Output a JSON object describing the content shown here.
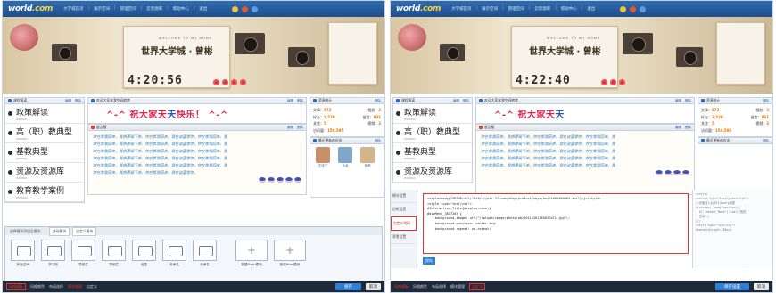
{
  "header": {
    "logo": "world",
    "logo_suffix": ".com",
    "nav": [
      "大学城首页",
      "展示空间",
      "管理空间",
      "云资源库",
      "帮助中心",
      "退出"
    ]
  },
  "banner": {
    "title": "世界大学城 · 曾彬",
    "subtitle": "WELCOME TO MY HOME",
    "clock_left": "4:20:56",
    "clock_right": "4:22:40"
  },
  "left_panel": {
    "categories_head": {
      "title": "课程解读",
      "edit": "编辑",
      "delete": "删除"
    },
    "categories": [
      {
        "name": "政策解读",
        "sub": "worlduc"
      },
      {
        "name": "高（职）教典型",
        "sub": "worlduc"
      },
      {
        "name": "基教典型",
        "sub": "worlduc"
      },
      {
        "name": "资源及资源库",
        "sub": "worlduc"
      },
      {
        "name": "教育教学案例",
        "sub": "worlduc"
      }
    ],
    "greeting_head": {
      "title": "欢迎大家来我空间转转",
      "edit": "编辑",
      "delete": "删除"
    },
    "greeting_prefix": "^-^ 祝大家天",
    "greeting_mid": "天",
    "greeting_suffix": "快乐！ ^-^",
    "notes_head": {
      "title": "留言板",
      "edit": "编辑",
      "delete": "删除"
    },
    "note_lines": [
      "你在等我回来，我想要留下来，你在等我回来，我在这里等你，你在等我回来，我",
      "你在等我回来，我想要留下来，你在等我回来，我在这里等你，你在等我回来，我",
      "你在等我回来，我想要留下来，你在等我回来，我在这里等你，你在等我回来，我",
      "你在等我回来，我想要留下来，你在等我回来，我在这里等你，你在等我回来，我",
      "你在等我回来，我想要留下来，你在等我回来，我在这里等你，你在等我回来，我",
      "你在等我回来，我想要留下来，你在等我回来，我在这里等你。"
    ],
    "stats_head": {
      "title": "资源统计",
      "delete": "删除"
    },
    "stats": [
      {
        "k1": "文章：",
        "v1": "572",
        "k2": "相册：",
        "v2": "3"
      },
      {
        "k1": "好友：",
        "v1": "2,520",
        "k2": "留言：",
        "v2": "831"
      },
      {
        "k1": "关注：",
        "v1": "5",
        "k2": "视频：",
        "v2": "3"
      },
      {
        "k1": "访问量：",
        "v1": "150,595",
        "k2": "",
        "v2": ""
      }
    ],
    "friends_head": {
      "title": "最近更新的好友",
      "delete": "删除"
    },
    "friends": [
      "王佳宁",
      "马龙",
      "孙莉",
      "陈美",
      "李华",
      "曾彬"
    ],
    "tray": {
      "lead": "选择模块添加至模块：",
      "tabs": [
        "基础模块",
        "自定义模块"
      ],
      "modules": [
        "完全空间",
        "学习档",
        "导航栏",
        "导航栏",
        "信息",
        "未命名",
        "未命名"
      ],
      "plus": [
        "+",
        "+"
      ],
      "plus_labels": [
        "新建Flash模块",
        "新建Html模块"
      ]
    },
    "footer": {
      "tabs": [
        "风格模板",
        "风格颜色",
        "布局选择",
        "模块管理",
        "自定义"
      ],
      "save": "保存",
      "cancel": "取消"
    }
  },
  "right_panel": {
    "side_items": [
      "模块设置",
      "边框设置",
      "自定义代码",
      "背景设置"
    ],
    "code_lines": [
      "<style>body{CURSOR:url(\"http://pic.51.com/shop/product/sbys/ani/1000400004.ani\");}</style>",
      "",
      "<style type=\"text/css\">",
      "#Information_Title{display:none;}",
      "#divMenu_3837265 {",
      "    background-image: url(\"/upload/image/photo/a0/201112615656JGoTi.jpg\");",
      "    background-position: center top;",
      "    background-repeat: no-repeat;"
    ],
    "side_code": [
      "<style>",
      "<script type=\"text/javascript\">",
      "//页面载入后执行jQuery函数",
      "$(window).load(function(){",
      "  $(\".Header_Name\").html(\"我的",
      "  空间\");",
      "});",
      "<style type=\"text/css\">",
      "#banner{height:185px}"
    ],
    "code_save": "保存",
    "footer": {
      "tabs": [
        "风格模板",
        "风格颜色",
        "布局选择",
        "模块管理",
        "自定义"
      ],
      "save": "保存设置",
      "cancel": "取消"
    }
  },
  "colors": {
    "accent": "#e8332a",
    "nav_blue": "#2f6bb0",
    "button_blue": "#2f7fd6",
    "footer_bg": "#1e2a39"
  }
}
